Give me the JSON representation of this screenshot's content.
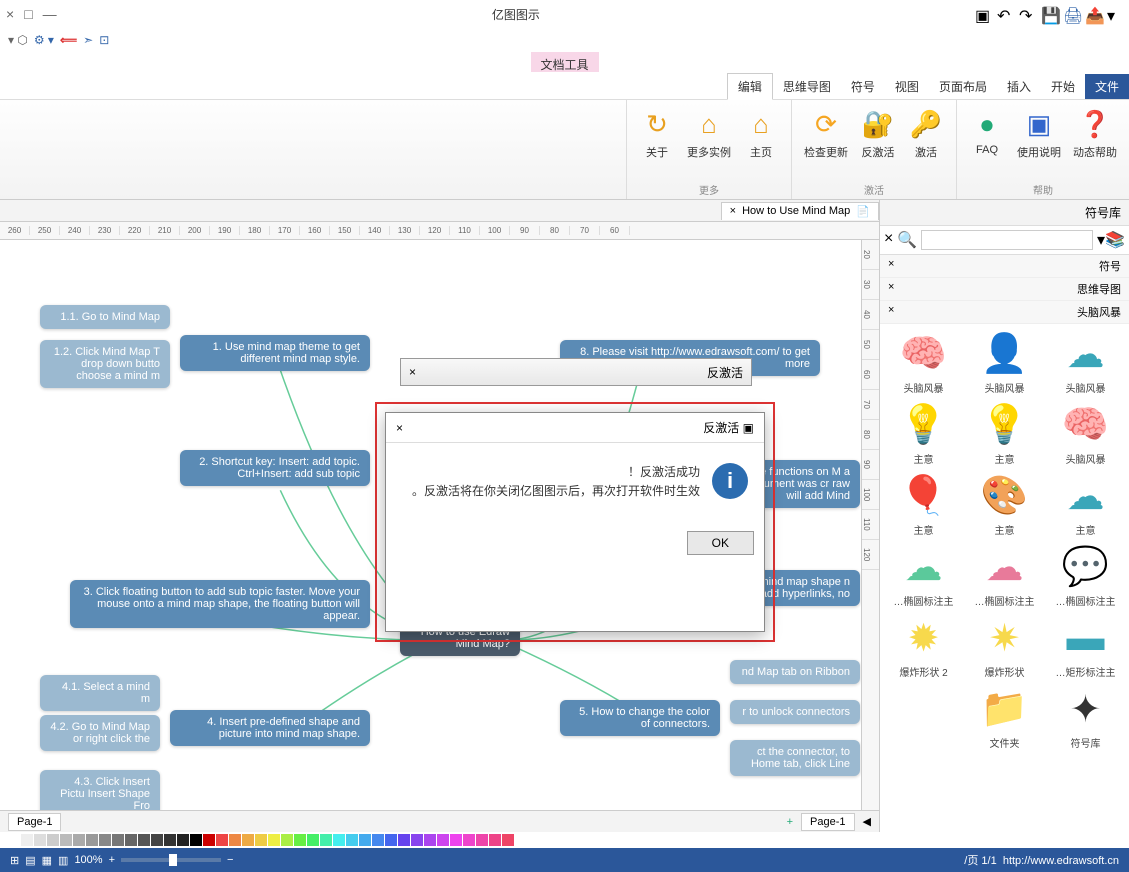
{
  "title": "亿图图示",
  "contextTab": "文档工具",
  "window": {
    "min": "—",
    "max": "□",
    "close": "×"
  },
  "tabs": [
    "文件",
    "开始",
    "插入",
    "页面布局",
    "视图",
    "符号",
    "思维导图",
    "编辑"
  ],
  "activeTab": "编辑",
  "ribbon": {
    "groups": [
      {
        "name": "帮助",
        "buttons": [
          {
            "label": "动态帮助",
            "icon": "❓",
            "color": "#2b7"
          },
          {
            "label": "使用说明",
            "icon": "▣",
            "color": "#36c"
          },
          {
            "label": "FAQ",
            "icon": "●",
            "color": "#2a7"
          }
        ]
      },
      {
        "name": "激活",
        "buttons": [
          {
            "label": "激活",
            "icon": "🔑",
            "color": "#e8a020"
          },
          {
            "label": "反激活",
            "icon": "🔐",
            "color": "#e8a020"
          },
          {
            "label": "检查更新",
            "icon": "⟳",
            "color": "#f5a623"
          }
        ]
      },
      {
        "name": "更多",
        "buttons": [
          {
            "label": "主页",
            "icon": "⌂",
            "color": "#e8a020"
          },
          {
            "label": "更多实例",
            "icon": "⌂",
            "color": "#e8a020"
          },
          {
            "label": "关于",
            "icon": "↻",
            "color": "#e8a020"
          }
        ]
      }
    ]
  },
  "sidePanel": {
    "title": "符号库",
    "categories": [
      "符号",
      "思维导图",
      "头脑风暴"
    ],
    "shapes": [
      {
        "label": "头脑风暴",
        "icon": "☁",
        "color": "#3aa6b9"
      },
      {
        "label": "头脑风暴",
        "icon": "👤",
        "color": "#3aa6b9"
      },
      {
        "label": "头脑风暴",
        "icon": "🧠",
        "color": "#e87a7a"
      },
      {
        "label": "头脑风暴",
        "icon": "🧠",
        "color": "#e8a87a"
      },
      {
        "label": "主意",
        "icon": "💡",
        "color": "#3aa6b9"
      },
      {
        "label": "主意",
        "icon": "💡",
        "color": "#f7d94c"
      },
      {
        "label": "主意",
        "icon": "☁",
        "color": "#3aa6b9"
      },
      {
        "label": "主意",
        "icon": "🎨",
        "color": "#5bc99b"
      },
      {
        "label": "主意",
        "icon": "🎈",
        "color": "#f7d94c"
      },
      {
        "label": "椭圆标注主…",
        "icon": "💬",
        "color": "#3aa6b9"
      },
      {
        "label": "椭圆标注主…",
        "icon": "☁",
        "color": "#e87a9a"
      },
      {
        "label": "椭圆标注主…",
        "icon": "☁",
        "color": "#5bc99b"
      },
      {
        "label": "矩形标注主…",
        "icon": "▬",
        "color": "#3aa6b9"
      },
      {
        "label": "爆炸形状",
        "icon": "✷",
        "color": "#f7d94c"
      },
      {
        "label": "爆炸形状 2",
        "icon": "✹",
        "color": "#f7d94c"
      },
      {
        "label": "符号库",
        "icon": "✦",
        "color": "#333"
      },
      {
        "label": "文件夹",
        "icon": "📁",
        "color": "#f7d94c"
      }
    ]
  },
  "docTab": {
    "name": "How to Use Mind Map",
    "close": "×"
  },
  "rulerH": [
    "260",
    "250",
    "240",
    "230",
    "220",
    "210",
    "200",
    "190",
    "180",
    "170",
    "160",
    "150",
    "140",
    "130",
    "120",
    "110",
    "100",
    "90",
    "80",
    "70",
    "60"
  ],
  "rulerV": [
    "20",
    "30",
    "40",
    "50",
    "60",
    "70",
    "80",
    "90",
    "100",
    "110",
    "120"
  ],
  "mindmap": {
    "center": "How to use\nEdraw Mind Map?",
    "n1": "1.   Use mind map theme to\nget different mind map style.",
    "n11": "1.1.   Go to Mind Map",
    "n12": "1.2.   Click Mind Map T\ndrop down butto\nchoose a mind m",
    "n2": "2.   Shortcut key:\nInsert: add topic.\nCtrl+Insert: add sub topic",
    "n3": "3.   Click floating button to add sub topic faster.\nMove your mouse onto a mind map shape,\nthe floating button will appear.",
    "n4": "4.   Insert pre-defined shape and\npicture into mind map shape.",
    "n41": "4.1.   Select a mind m",
    "n42": "4.2.   Go to Mind Map\nor right click the",
    "n43": "4.3.   Click Insert Pictu\nInsert Shape Fro",
    "n5": "5.   How to change the\ncolor of connectors.",
    "n51": "nd Map tab on Ribbon",
    "n52": "r to unlock connectors",
    "n53": "ct the connector,\nto Home tab, click Line",
    "n6": "lick mind map shape\nn add hyperlinks, no",
    "n7": "ore functions on M\na document was cr\nraw will add Mind",
    "n8": "8.   Please visit http://www.edrawsoft.com/\nto get more"
  },
  "dialog": {
    "title": "反激活",
    "miniTitle": "反激活",
    "msg1": "反激活成功！",
    "msg2": "反激活将在你关闭亿图图示后，再次打开软件时生效。",
    "ok": "OK",
    "actBtn": "反激活"
  },
  "pageTabs": {
    "p1": "Page-1",
    "p2": "Page-1",
    "add": "+"
  },
  "colors": [
    "#fff",
    "#eee",
    "#ddd",
    "#ccc",
    "#bbb",
    "#aaa",
    "#999",
    "#888",
    "#777",
    "#666",
    "#555",
    "#444",
    "#333",
    "#222",
    "#000",
    "#c00",
    "#e44",
    "#e84",
    "#ea4",
    "#ec4",
    "#ee4",
    "#ae4",
    "#6e4",
    "#4e6",
    "#4ea",
    "#4ee",
    "#4ce",
    "#4ae",
    "#48e",
    "#46e",
    "#64e",
    "#84e",
    "#a4e",
    "#c4e",
    "#e4e",
    "#e4c",
    "#e4a",
    "#e48",
    "#e46"
  ],
  "status": {
    "page": "页 1/1",
    "url": "http://www.edrawsoft.cn/",
    "zoom": "100%"
  }
}
